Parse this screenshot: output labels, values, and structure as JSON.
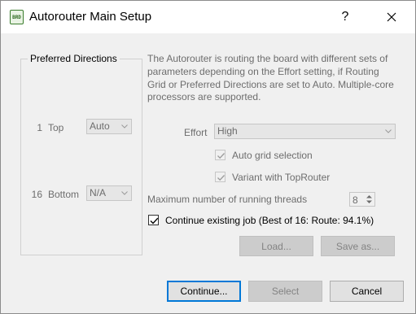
{
  "window": {
    "title": "Autorouter Main Setup",
    "app_icon_text": "BRD",
    "help_symbol": "?",
    "close_icon": "close-icon"
  },
  "preferred_directions": {
    "title": "Preferred Directions",
    "layers": [
      {
        "number": "1",
        "name": "Top",
        "value": "Auto"
      },
      {
        "number": "16",
        "name": "Bottom",
        "value": "N/A"
      }
    ]
  },
  "description": "The Autorouter is routing the board with different sets of parameters depending on the Effort setting, if Routing Grid or Preferred Directions are set to Auto. Multiple-core processors are supported.",
  "effort": {
    "label": "Effort",
    "value": "High"
  },
  "options": {
    "auto_grid": {
      "label": "Auto grid selection",
      "checked": true,
      "enabled": false
    },
    "variant": {
      "label": "Variant with TopRouter",
      "checked": true,
      "enabled": false
    }
  },
  "threads": {
    "label": "Maximum number of running threads",
    "value": "8"
  },
  "continue_job": {
    "label": "Continue existing job (Best of 16: Route: 94.1%)",
    "checked": true
  },
  "buttons": {
    "load": "Load...",
    "save_as": "Save as...",
    "continue": "Continue...",
    "select": "Select",
    "cancel": "Cancel"
  },
  "colors": {
    "dialog_bg": "#f0f0f0",
    "disabled_text": "#6d6d6d",
    "default_button_border": "#0078d7"
  }
}
